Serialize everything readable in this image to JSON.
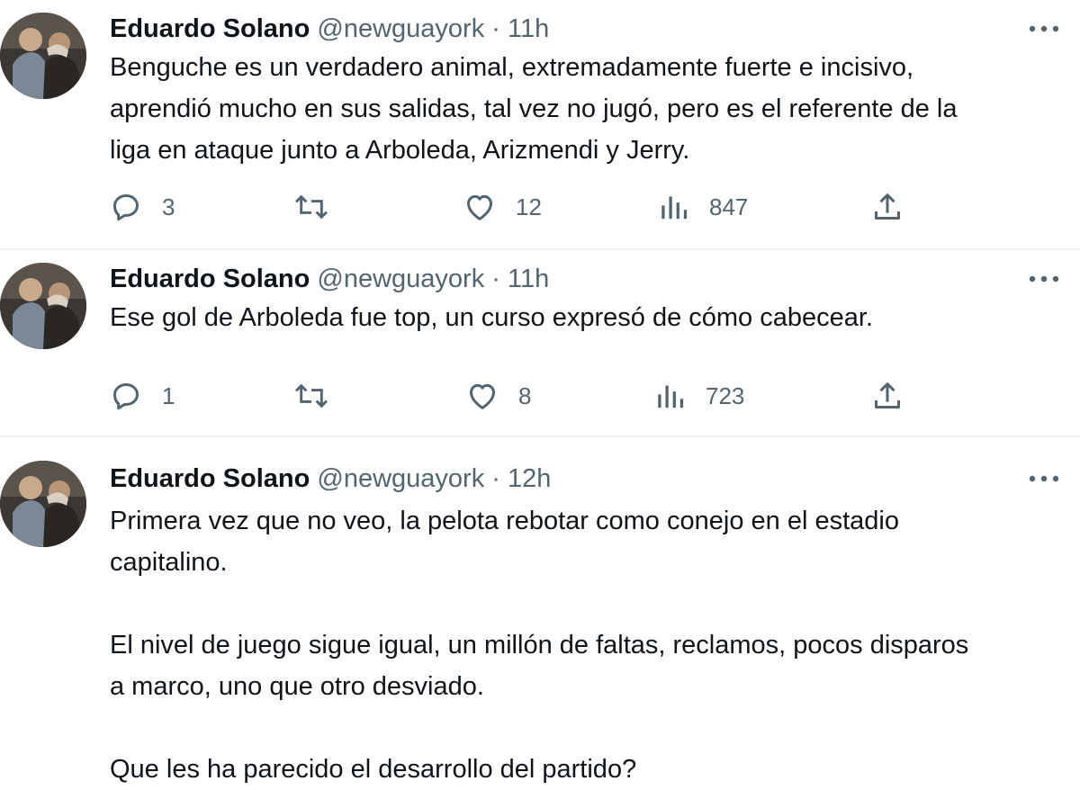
{
  "tweets": [
    {
      "author_name": "Eduardo Solano",
      "handle": "@newguayork",
      "separator": "·",
      "time": "11h",
      "text": "Benguche es un verdadero animal, extremadamente fuerte e incisivo,\naprendió mucho en sus salidas, tal vez no jugó, pero es el referente de la\nliga en ataque junto a Arboleda, Arizmendi y Jerry.",
      "replies": "3",
      "retweets": "",
      "likes": "12",
      "views": "847"
    },
    {
      "author_name": "Eduardo Solano",
      "handle": "@newguayork",
      "separator": "·",
      "time": "11h",
      "text": "Ese gol de Arboleda fue top, un curso expresó de cómo cabecear.",
      "replies": "1",
      "retweets": "",
      "likes": "8",
      "views": "723"
    },
    {
      "author_name": "Eduardo Solano",
      "handle": "@newguayork",
      "separator": "·",
      "time": "12h",
      "text": "Primera vez que no veo,  la pelota rebotar como conejo en el estadio\ncapitalino.\n\nEl nivel de juego sigue igual, un millón de faltas, reclamos, pocos disparos\na marco, uno que otro desviado.\n\nQue les ha parecido el desarrollo del partido?"
    }
  ],
  "icons": {
    "reply": "reply-icon",
    "retweet": "retweet-icon",
    "like": "heart-icon",
    "views": "views-icon",
    "share": "share-icon",
    "more": "more-icon"
  },
  "colors": {
    "text": "#0f1419",
    "secondary": "#536471",
    "divider": "#eff3f4"
  }
}
